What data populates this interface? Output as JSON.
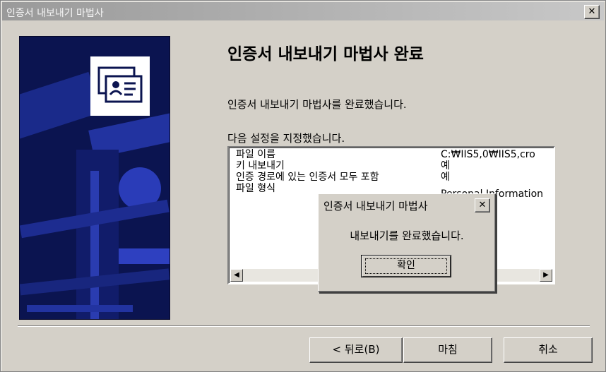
{
  "window": {
    "title": "인증서 내보내기 마법사",
    "close_glyph": "✕"
  },
  "main": {
    "heading": "인증서 내보내기 마법사 완료",
    "complete_text": "인증서 내보내기 마법사를 완료했습니다.",
    "settings_label": "다음 설정을 지정했습니다.",
    "settings": [
      {
        "name": "파일 이름",
        "value": "C:₩IIS5,0₩IIS5,cro"
      },
      {
        "name": "키 내보내기",
        "value": "예"
      },
      {
        "name": "인증 경로에 있는 인증서 모두 포함",
        "value": "예"
      },
      {
        "name": "파일 형식",
        "value": "Personal Information"
      }
    ],
    "scroll_left": "◀",
    "scroll_right": "▶"
  },
  "buttons": {
    "back": "< 뒤로(B)",
    "finish": "마침",
    "cancel": "취소"
  },
  "popup": {
    "title": "인증서 내보내기 마법사",
    "close_glyph": "✕",
    "message": "내보내기를 완료했습니다.",
    "ok": "확인"
  },
  "colors": {
    "banner": "#0b1450",
    "dialog": "#d4d0c8"
  },
  "icons": {
    "banner": "certificate-icon"
  }
}
